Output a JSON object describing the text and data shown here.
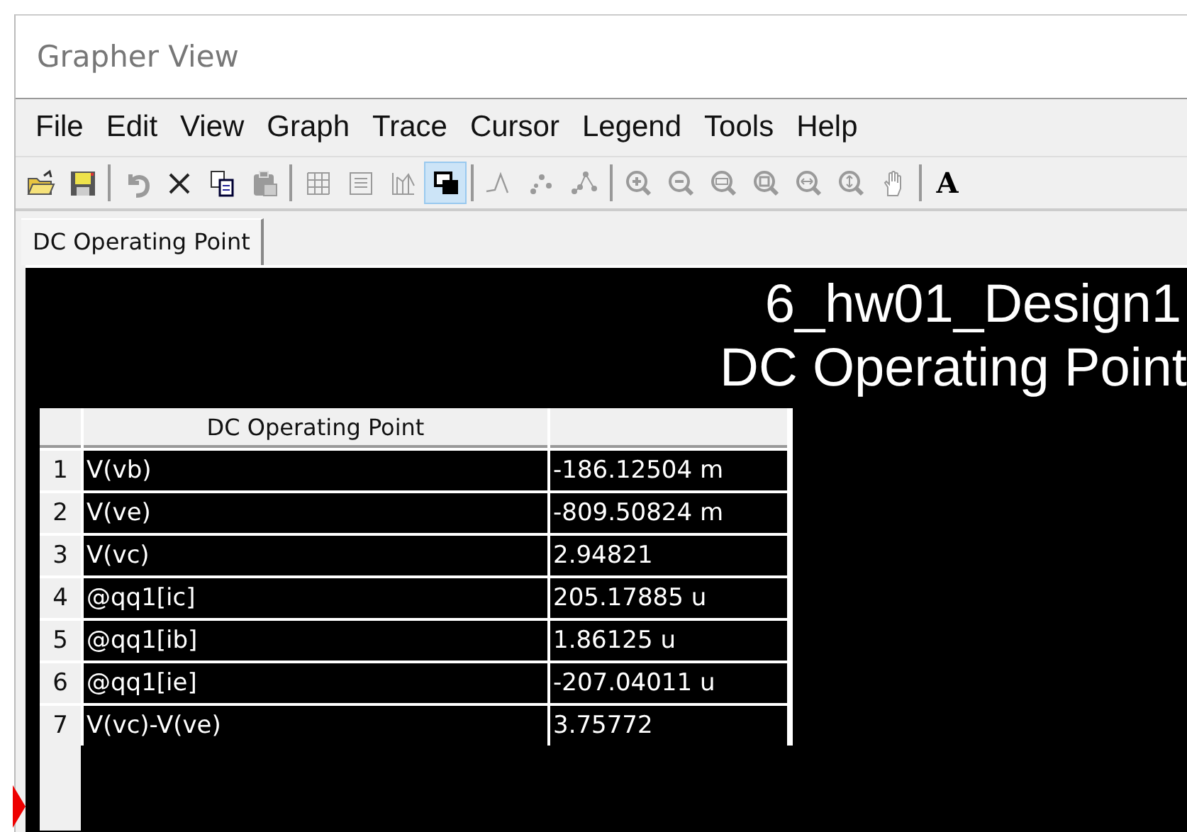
{
  "window": {
    "title": "Grapher View"
  },
  "menu": [
    "File",
    "Edit",
    "View",
    "Graph",
    "Trace",
    "Cursor",
    "Legend",
    "Tools",
    "Help"
  ],
  "toolbar": [
    {
      "kind": "open",
      "selected": false
    },
    {
      "kind": "save",
      "selected": false
    },
    {
      "kind": "sep"
    },
    {
      "kind": "undo",
      "selected": false
    },
    {
      "kind": "delete",
      "selected": false
    },
    {
      "kind": "copy",
      "selected": false
    },
    {
      "kind": "paste",
      "selected": false
    },
    {
      "kind": "sep"
    },
    {
      "kind": "grid",
      "selected": false
    },
    {
      "kind": "list",
      "selected": false
    },
    {
      "kind": "bars",
      "selected": false
    },
    {
      "kind": "overlay",
      "selected": true
    },
    {
      "kind": "sep"
    },
    {
      "kind": "peak",
      "selected": false
    },
    {
      "kind": "dots",
      "selected": false
    },
    {
      "kind": "dotline",
      "selected": false
    },
    {
      "kind": "sep"
    },
    {
      "kind": "zoomin",
      "selected": false
    },
    {
      "kind": "zoomout",
      "selected": false
    },
    {
      "kind": "zoomfit",
      "selected": false
    },
    {
      "kind": "zoombox",
      "selected": false
    },
    {
      "kind": "zoomx",
      "selected": false
    },
    {
      "kind": "zoomy",
      "selected": false
    },
    {
      "kind": "hand",
      "selected": false
    },
    {
      "kind": "sep"
    },
    {
      "kind": "font",
      "glyph": "A",
      "selected": false
    }
  ],
  "tabs": [
    {
      "label": "DC Operating Point",
      "selected": true
    }
  ],
  "plot": {
    "title_lines": [
      "6_hw01_Design1",
      "DC Operating Point"
    ],
    "table": {
      "columns": [
        "DC Operating Point"
      ],
      "rows": [
        {
          "index": "1",
          "name": "V(vb)",
          "value": "-186.12504 m"
        },
        {
          "index": "2",
          "name": "V(ve)",
          "value": "-809.50824 m"
        },
        {
          "index": "3",
          "name": "V(vc)",
          "value": "2.94821"
        },
        {
          "index": "4",
          "name": "@qq1[ic]",
          "value": "205.17885 u"
        },
        {
          "index": "5",
          "name": "@qq1[ib]",
          "value": "1.86125 u"
        },
        {
          "index": "6",
          "name": "@qq1[ie]",
          "value": "-207.04011 u"
        },
        {
          "index": "7",
          "name": "V(vc)-V(ve)",
          "value": "3.75772"
        }
      ]
    }
  }
}
